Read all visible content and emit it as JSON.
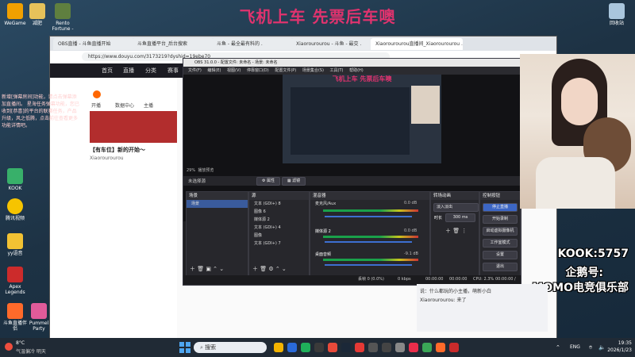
{
  "banner": {
    "text": "飞机上车    先票后车噢"
  },
  "desktop_icons": [
    {
      "label": "WeGame",
      "color": "#f0a000"
    },
    {
      "label": "减肥",
      "color": "#e6c25a"
    },
    {
      "label": "Rento Fortune -",
      "color": "#5f7f3f"
    },
    {
      "label": "回收站",
      "color": "#a9c6dd"
    }
  ],
  "left_labels": [
    "腾讯视频",
    "冒险记",
    "OBS",
    "yy语音",
    "Apex Legends",
    "斗鱼直播伴侣",
    "Pummel Party",
    "KOOK",
    "QQ音乐",
    "小火箭",
    "数据中心",
    "英雄联盟"
  ],
  "notice": {
    "text": "新增[弹幕房间]功能，请点击弹幕添加直播间。 星海任务弹幕功能，您已收到[恭喜]的平台的联赛任务，产品升级，风之低腾，点击前往查看更多功能详情吧。"
  },
  "browser": {
    "tabs": [
      "OBS直播 - 斗鱼直播开始",
      "斗鱼直播平台_后台搜索",
      "斗鱼 - 最全最有料的 .",
      "Xiaorourourou - 斗鱼 - 最交 .",
      "Xiaorourourou直播间_Xiaorourourou ."
    ],
    "url": "https://www.douyu.com/3173219?dyshid=19ebe70",
    "nav": [
      "首页",
      "直播",
      "分类",
      "赛事"
    ],
    "tools": [
      "开播",
      "数据中心",
      "主播"
    ],
    "stream_title": "【有车位】新的开始～",
    "streamer": "Xiaorourourou",
    "likes": "关注"
  },
  "obs": {
    "title": "OBS 31.0.0 - 配置文件: 未命名 - 场景: 未命名",
    "menu": [
      "文件(F)",
      "编辑(E)",
      "视图(V)",
      "停靠窗口(D)",
      "配置文件(P)",
      "场景集合(S)",
      "工具(T)",
      "帮助(H)"
    ],
    "zoom": "29%",
    "zoom_label": "播放预览",
    "no_source": "未选择源",
    "properties_btn": "属性",
    "filters_btn": "滤镜",
    "panels": {
      "scenes": {
        "title": "场景",
        "items": [
          "场景"
        ]
      },
      "sources": {
        "title": "源",
        "items": [
          "文本 (GDI+) 8",
          "图像 6",
          "媒体源 2",
          "文本 (GDI+) 4",
          "图像",
          "文本 (GDI+) 7"
        ]
      },
      "mixer": {
        "title": "混音器",
        "channels": [
          {
            "name": "麦克风/Aux",
            "db": "0.0 dB"
          },
          {
            "name": "媒体源 2",
            "db": "0.0 dB"
          },
          {
            "name": "桌面音频",
            "db": "-9.1 dB"
          }
        ]
      },
      "transitions": {
        "title": "转场动画",
        "type": "淡入淡出",
        "duration_label": "时长",
        "duration": "300 ms"
      },
      "controls": {
        "title": "控制按钮",
        "buttons": [
          "停止直播",
          "开始录制",
          "启动虚拟摄像机",
          "工作室模式",
          "设置",
          "退出"
        ]
      }
    },
    "status": {
      "frames": "丢帧 0 (0.0%)",
      "bitrate": "0 kbps",
      "rec": "00:00:00",
      "live": "00:00:00",
      "cpu": "CPU: 2.3%",
      "fps": "00:00:00 / 60.00 FPS"
    }
  },
  "chat": {
    "messages": [
      "说：什么都玩的小主播，萌新小白",
      "Xiaorourourou: 来了"
    ]
  },
  "watermark": {
    "line1": "KOOK:5757",
    "line2": "企鹅号:",
    "line3": "MOMO电竞俱乐部"
  },
  "taskbar": {
    "weather_temp": "8°C",
    "weather_text": "气温偏冷 明天",
    "search_placeholder": "搜索",
    "lang": "ENG",
    "time": "19:35",
    "date": "2026/1/23"
  }
}
